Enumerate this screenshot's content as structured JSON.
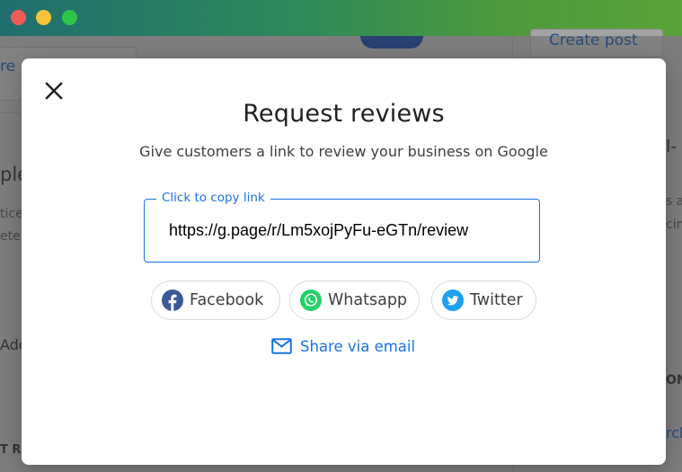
{
  "window": {
    "traffic_lights": [
      "close",
      "minimize",
      "zoom"
    ]
  },
  "background": {
    "create_post_label": "Create post",
    "fragments": {
      "left_top": "re",
      "left_heading": "ple",
      "left_line1": "tice",
      "left_line2": "ete",
      "left_add": "Add",
      "left_bottom": "T R",
      "right_heading": "l-",
      "right_line1": "s a",
      "right_line2": "cin",
      "right_on": "ON",
      "right_arch": "rch"
    }
  },
  "dialog": {
    "title": "Request reviews",
    "subtitle": "Give customers a link to review your business on Google",
    "close_icon": "close-icon",
    "link_field": {
      "label": "Click to copy link",
      "value": "https://g.page/r/Lm5xojPyFu-eGTn/review"
    },
    "share_buttons": [
      {
        "label": "Facebook",
        "icon": "facebook-icon",
        "color": "#3b5998"
      },
      {
        "label": "Whatsapp",
        "icon": "whatsapp-icon",
        "color": "#25d366"
      },
      {
        "label": "Twitter",
        "icon": "twitter-icon",
        "color": "#1da1f2"
      }
    ],
    "email_share": {
      "label": "Share via email",
      "icon": "mail-icon",
      "color": "#1a73e8"
    }
  }
}
